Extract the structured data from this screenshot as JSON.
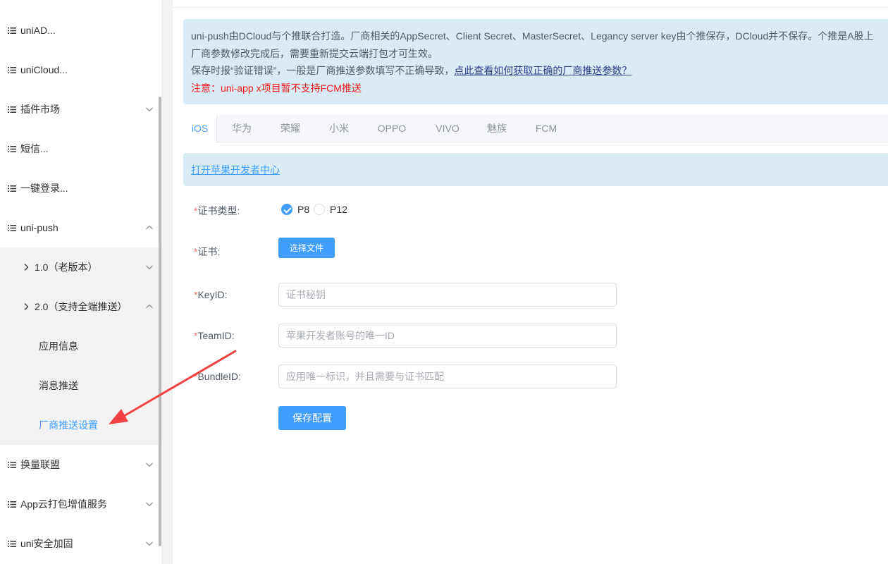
{
  "sidebar": {
    "items": [
      {
        "label": "uniAD...",
        "has_chevron": false
      },
      {
        "label": "uniCloud...",
        "has_chevron": false
      },
      {
        "label": "插件市场",
        "has_chevron": true,
        "chevron": "down"
      },
      {
        "label": "短信...",
        "has_chevron": false
      },
      {
        "label": "一键登录...",
        "has_chevron": false
      },
      {
        "label": "uni-push",
        "has_chevron": true,
        "chevron": "up"
      },
      {
        "label": "换量联盟",
        "has_chevron": true,
        "chevron": "down"
      },
      {
        "label": "App云打包增值服务",
        "has_chevron": true,
        "chevron": "down"
      },
      {
        "label": "uni安全加固",
        "has_chevron": true,
        "chevron": "down"
      }
    ],
    "sub_items": [
      {
        "label": "1.0（老版本）",
        "chevron": "down"
      },
      {
        "label": "2.0（支持全端推送）",
        "chevron": "up"
      },
      {
        "label": "应用信息"
      },
      {
        "label": "消息推送"
      },
      {
        "label": "厂商推送设置",
        "active": true
      }
    ]
  },
  "notice": {
    "line1": "uni-push由DCloud与个推联合打造。厂商相关的AppSecret、Client Secret、MasterSecret、Legancy server key由个推保存，DCloud并不保存。个推是A股上",
    "line2": "厂商参数修改完成后，需要重新提交云端打包才可生效。",
    "line3_prefix": "保存时报“验证错误”，一般是厂商推送参数填写不正确导致，",
    "line3_link": "点此查看如何获取正确的厂商推送参数？",
    "line4": "注意：uni-app x项目暂不支持FCM推送"
  },
  "tabs": [
    "iOS",
    "华为",
    "荣耀",
    "小米",
    "OPPO",
    "VIVO",
    "魅族",
    "FCM"
  ],
  "active_tab": "iOS",
  "dev_banner": {
    "link": "打开苹果开发者中心"
  },
  "form": {
    "cert_type_label": "证书类型:",
    "cert_type_options": [
      "P8",
      "P12"
    ],
    "cert_type_selected": "P8",
    "cert_label": "证书:",
    "choose_file_label": "选择文件",
    "keyid_label": "KeyID:",
    "keyid_placeholder": "证书秘钥",
    "teamid_label": "TeamID:",
    "teamid_placeholder": "苹果开发者账号的唯一ID",
    "bundleid_label": "BundleID:",
    "bundleid_placeholder": "应用唯一标识，并且需要与证书匹配",
    "required_mark": "*",
    "save_label": "保存配置"
  },
  "colors": {
    "accent": "#409eff",
    "notice_bg": "#d9ecf5",
    "warning": "#f01818",
    "annotation_arrow": "#f04242"
  }
}
